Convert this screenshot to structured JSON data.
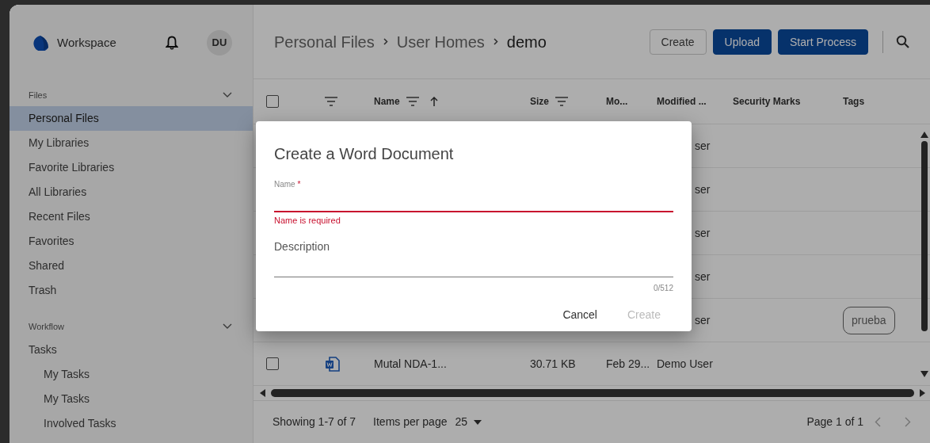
{
  "sidebar": {
    "brand": "Workspace",
    "avatar": "DU",
    "sections": [
      {
        "title": "Files",
        "expanded": true,
        "items": [
          {
            "label": "Personal Files",
            "selected": true
          },
          {
            "label": "My Libraries",
            "selected": false
          },
          {
            "label": "Favorite Libraries",
            "selected": false
          },
          {
            "label": "All Libraries",
            "selected": false
          },
          {
            "label": "Recent Files",
            "selected": false
          },
          {
            "label": "Favorites",
            "selected": false
          },
          {
            "label": "Shared",
            "selected": false
          },
          {
            "label": "Trash",
            "selected": false
          }
        ]
      },
      {
        "title": "Workflow",
        "expanded": true,
        "items": [
          {
            "label": "Tasks",
            "selected": false,
            "children": [
              {
                "label": "My Tasks",
                "selected": false
              },
              {
                "label": "My Tasks",
                "selected": false
              },
              {
                "label": "Involved Tasks",
                "selected": false
              }
            ]
          }
        ]
      }
    ]
  },
  "header": {
    "breadcrumb": [
      "Personal Files",
      "User Homes",
      "demo"
    ],
    "buttons": [
      {
        "label": "Create",
        "kind": "outline"
      },
      {
        "label": "Upload",
        "kind": "primary"
      },
      {
        "label": "Start Process",
        "kind": "primary"
      }
    ]
  },
  "table": {
    "columns": [
      {
        "kind": "checkbox",
        "checked": false
      },
      {
        "kind": "filter"
      },
      {
        "kind": "text",
        "label": "Name",
        "filter": true,
        "sorted": true
      },
      {
        "kind": "text",
        "label": "Size",
        "filter": true,
        "sorted": false
      },
      {
        "kind": "text",
        "label": "Mo...",
        "filter": false,
        "sorted": false
      },
      {
        "kind": "text",
        "label": "Modified ...",
        "filter": false,
        "sorted": false
      },
      {
        "kind": "text",
        "label": "Security Marks",
        "filter": false,
        "sorted": false
      },
      {
        "kind": "text",
        "label": "Tags",
        "filter": false,
        "sorted": false
      }
    ],
    "rows": [
      {
        "modified_by": "ser"
      },
      {
        "modified_by": "ser"
      },
      {
        "modified_by": "ser"
      },
      {
        "modified_by": "ser"
      },
      {
        "modified_by": "ser",
        "tags": [
          "prueba"
        ]
      },
      {
        "checked": false,
        "kind": "document",
        "name": "Mutal NDA-1...",
        "size": "30.71 KB",
        "modified": "Feb 29...",
        "modified_by": "Demo User"
      }
    ]
  },
  "footer": {
    "showing": "Showing 1-7 of 7",
    "items_per_page_label": "Items per page",
    "items_per_page": "25",
    "page": "Page 1 of 1"
  },
  "dialog": {
    "title": "Create a Word Document",
    "fields": [
      {
        "label": "Name",
        "required": true,
        "required_mark": "*",
        "invalid": true,
        "error": "Name is required"
      },
      {
        "label": "Description",
        "required": false,
        "invalid": false,
        "counter": "0/512"
      }
    ],
    "actions": [
      {
        "label": "Cancel",
        "disabled": false
      },
      {
        "label": "Create",
        "disabled": true
      }
    ]
  }
}
